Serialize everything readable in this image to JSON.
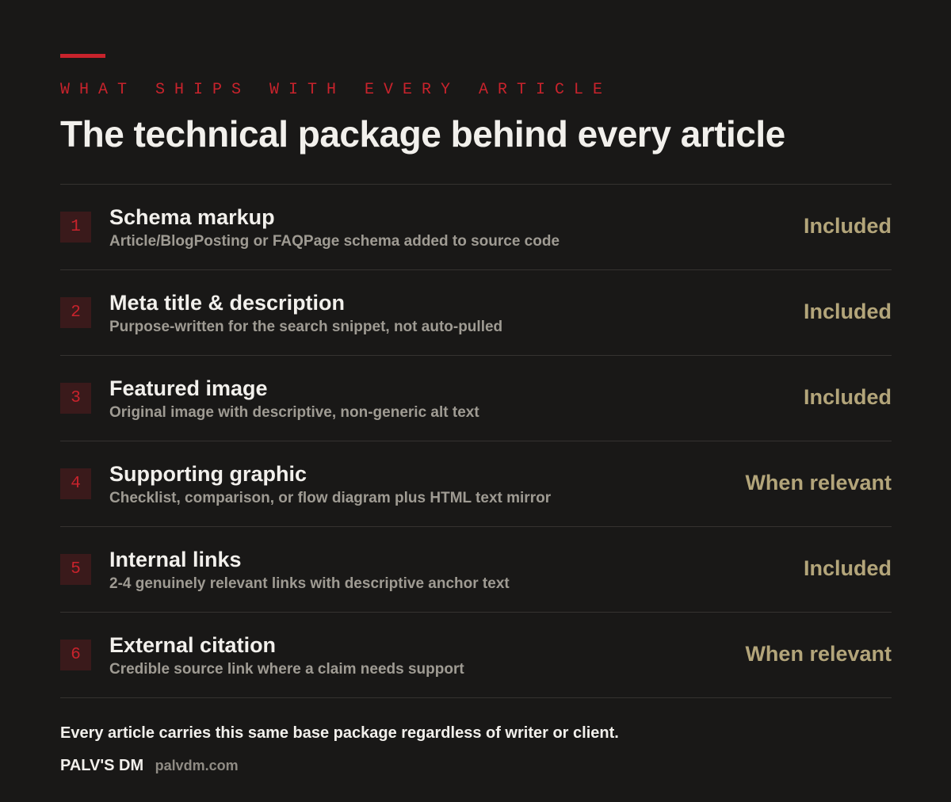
{
  "header": {
    "eyebrow": "WHAT SHIPS WITH EVERY ARTICLE",
    "title": "The technical package behind every article"
  },
  "items": [
    {
      "number": "1",
      "title": "Schema markup",
      "description": "Article/BlogPosting or FAQPage schema added to source code",
      "status": "Included"
    },
    {
      "number": "2",
      "title": "Meta title & description",
      "description": "Purpose-written for the search snippet, not auto-pulled",
      "status": "Included"
    },
    {
      "number": "3",
      "title": "Featured image",
      "description": "Original image with descriptive, non-generic alt text",
      "status": "Included"
    },
    {
      "number": "4",
      "title": "Supporting graphic",
      "description": "Checklist, comparison, or flow diagram plus HTML text mirror",
      "status": "When relevant"
    },
    {
      "number": "5",
      "title": "Internal links",
      "description": "2-4 genuinely relevant links with descriptive anchor text",
      "status": "Included"
    },
    {
      "number": "6",
      "title": "External citation",
      "description": "Credible source link where a claim needs support",
      "status": "When relevant"
    }
  ],
  "footer": {
    "note": "Every article carries this same base package regardless of writer or client.",
    "brand_name": "PALV'S DM",
    "brand_url": "palvdm.com"
  },
  "colors": {
    "background": "#191817",
    "accent": "#c8232c",
    "status": "#b3a57a"
  }
}
